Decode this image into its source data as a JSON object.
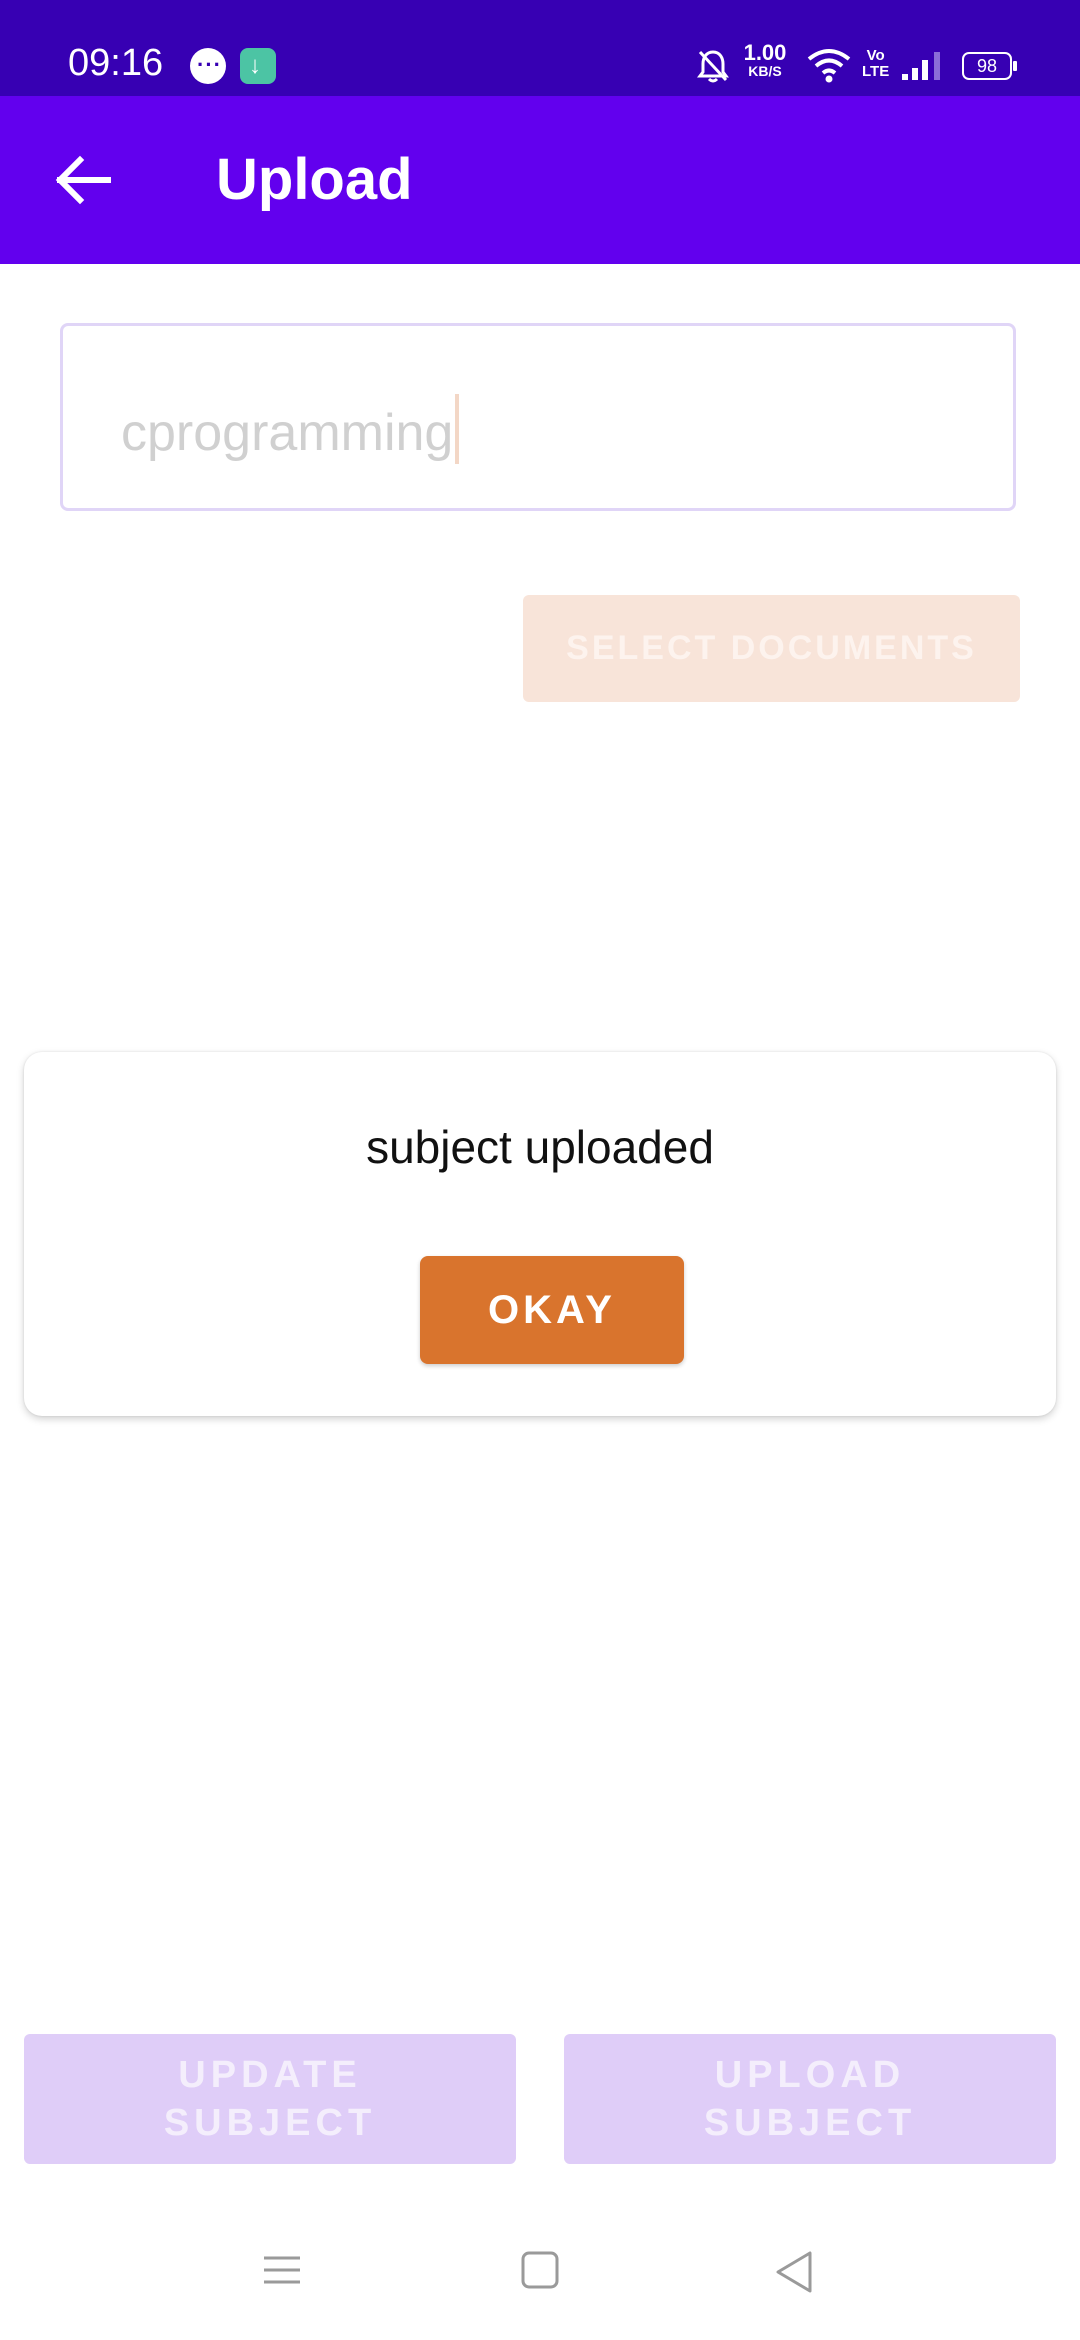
{
  "status_bar": {
    "time": "09:16",
    "network_speed_value": "1.00",
    "network_speed_unit": "KB/S",
    "volte_label_top": "Vo",
    "volte_label_bottom": "LTE",
    "battery_level": "98",
    "icons": [
      "message-icon",
      "download-icon",
      "mute-icon",
      "wifi-icon",
      "volte-icon",
      "signal-icon",
      "battery-icon"
    ]
  },
  "app_bar": {
    "title": "Upload",
    "back_icon": "arrow-left-icon"
  },
  "form": {
    "subject_value": "cprogramming",
    "select_documents_label": "SELECT DOCUMENTS"
  },
  "dialog": {
    "message": "subject uploaded",
    "okay_label": "OKAY"
  },
  "actions": {
    "update_label_line1": "UPDATE",
    "update_label_line2": "SUBJECT",
    "upload_label_line1": "UPLOAD",
    "upload_label_line2": "SUBJECT"
  },
  "nav_bar": {
    "icons": [
      "menu-icon",
      "home-icon",
      "back-triangle-icon"
    ]
  },
  "colors": {
    "status_bar": "#3700b3",
    "app_bar": "#6200ee",
    "okay_button": "#d9742d",
    "disabled_purple": "#dfcdf8",
    "disabled_orange": "#f8e4d9"
  }
}
